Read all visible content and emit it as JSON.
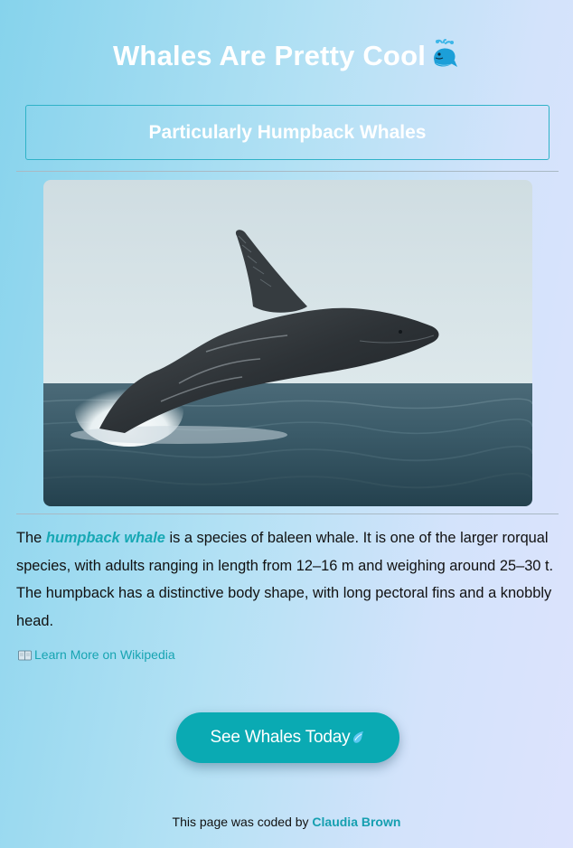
{
  "header": {
    "title": "Whales Are Pretty Cool",
    "title_icon": "spouting-whale-icon"
  },
  "subtitle": {
    "text": "Particularly Humpback Whales"
  },
  "image": {
    "subject": "humpback-whale-breaching-photo"
  },
  "description": {
    "prefix": "The ",
    "highlight": "humpback whale",
    "body": " is a species of baleen whale. It is one of the larger rorqual species, with adults ranging in length from 12–16 m and weighing around 25–30 t. The humpback has a distinctive body shape, with long pectoral fins and a knobbly head."
  },
  "wiki_link": {
    "icon": "open-book-icon",
    "label": "Learn More on Wikipedia"
  },
  "cta": {
    "label": "See Whales Today",
    "icon": "water-drop-icon"
  },
  "footer": {
    "prefix": "This page was coded by ",
    "author": "Claudia Brown"
  },
  "colors": {
    "accent": "#0aaab3",
    "link": "#17a4b2",
    "background_start": "#86d3ec",
    "background_end": "#dde3fd"
  }
}
